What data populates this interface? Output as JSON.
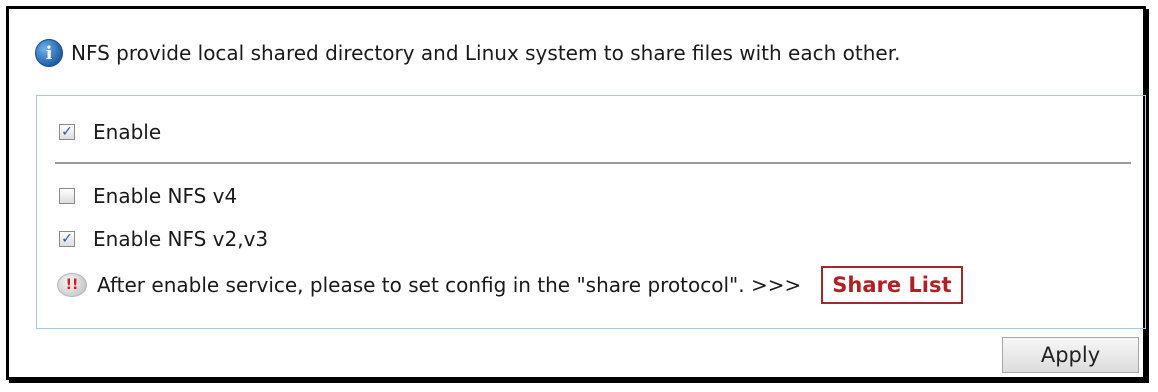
{
  "info": {
    "icon": "info-icon",
    "text": "NFS provide local shared directory and Linux system to share files with each other."
  },
  "options": [
    {
      "label": "Enable",
      "checked": true
    },
    {
      "label": "Enable NFS v4",
      "checked": false
    },
    {
      "label": "Enable NFS v2,v3",
      "checked": true
    }
  ],
  "warning": {
    "icon": "warning-icon",
    "glyph": "!!",
    "text": "After enable service, please to set config in the \"share protocol\". >>>",
    "link_label": "Share List"
  },
  "apply_label": "Apply",
  "colors": {
    "panel_border": "#a9c8e4",
    "link_red": "#b02024",
    "check_blue": "#2a55a8"
  }
}
